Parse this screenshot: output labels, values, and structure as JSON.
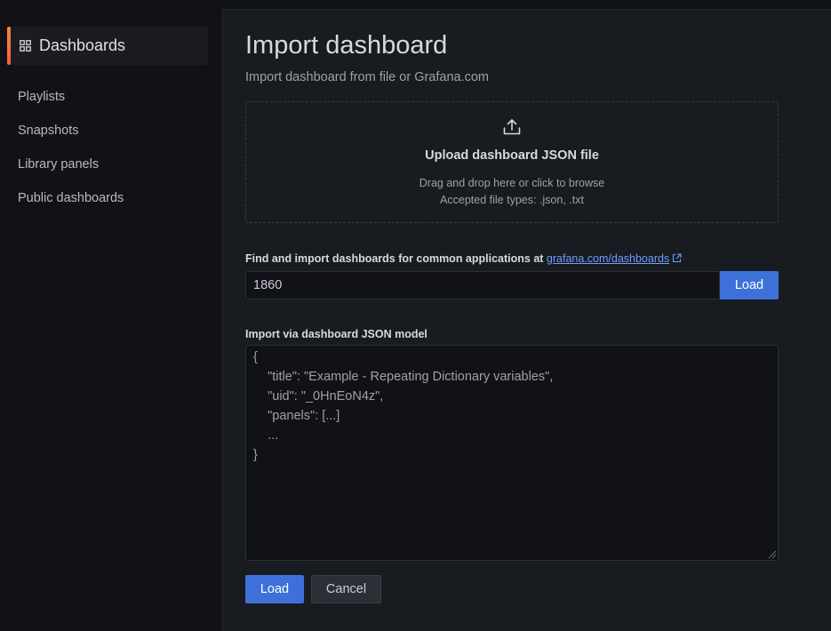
{
  "sidebar": {
    "active_label": "Dashboards",
    "items": [
      {
        "label": "Playlists"
      },
      {
        "label": "Snapshots"
      },
      {
        "label": "Library panels"
      },
      {
        "label": "Public dashboards"
      }
    ],
    "accent_color": "#ff8833"
  },
  "main": {
    "title": "Import dashboard",
    "subtitle": "Import dashboard from file or Grafana.com",
    "upload": {
      "icon": "upload-icon",
      "title": "Upload dashboard JSON file",
      "drag_text": "Drag and drop here or click to browse",
      "accepted": "Accepted file types: .json, .txt"
    },
    "find": {
      "label": "Find and import dashboards for common applications at ",
      "link_text": "grafana.com/dashboards",
      "input_value": "1860",
      "load_label": "Load"
    },
    "json_model": {
      "label": "Import via dashboard JSON model",
      "placeholder_lines": [
        "{",
        "    \"title\": \"Example - Repeating Dictionary variables\",",
        "    \"uid\": \"_0HnEoN4z\",",
        "    \"panels\": [...]",
        "    ...",
        "}"
      ]
    },
    "actions": {
      "load_label": "Load",
      "cancel_label": "Cancel"
    },
    "primary_color": "#3d71d9"
  }
}
